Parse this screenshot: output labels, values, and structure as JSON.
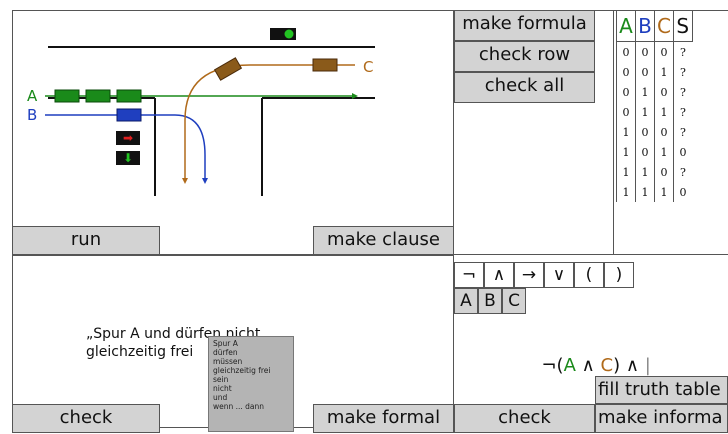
{
  "scene": {
    "lane_a_label": "A",
    "lane_b_label": "B",
    "lane_c_label": "C",
    "color_a": "#1a8a1a",
    "color_b": "#1f3fbf",
    "color_c": "#b06a1a",
    "traffic_light_state": "green"
  },
  "buttons": {
    "run": "run",
    "make_clause": "make clause",
    "make_formula": "make formula",
    "check_row": "check row",
    "check_all": "check all",
    "check_left": "check",
    "make_formal": "make formal",
    "check_right": "check",
    "fill_truth_table": "fill truth table",
    "make_informal": "make informa"
  },
  "truth_table": {
    "headers": [
      "A",
      "B",
      "C",
      "S"
    ],
    "rows": [
      [
        "0",
        "0",
        "0",
        "?"
      ],
      [
        "0",
        "0",
        "1",
        "?"
      ],
      [
        "0",
        "1",
        "0",
        "?"
      ],
      [
        "0",
        "1",
        "1",
        "?"
      ],
      [
        "1",
        "0",
        "0",
        "?"
      ],
      [
        "1",
        "0",
        "1",
        "0"
      ],
      [
        "1",
        "1",
        "0",
        "?"
      ],
      [
        "1",
        "1",
        "1",
        "0"
      ]
    ]
  },
  "sentence": {
    "line1": "„Spur A und dürfen nicht",
    "line2": "gleichzeitig frei"
  },
  "word_list": [
    "Spur A",
    "dürfen",
    "müssen",
    "gleichzeitig frei",
    "sein",
    "nicht",
    "und",
    "wenn ... dann"
  ],
  "operators": [
    "¬",
    "∧",
    "→",
    "∨",
    "(",
    ")"
  ],
  "variables": [
    "A",
    "B",
    "C"
  ],
  "formula": {
    "neg": "¬(",
    "a": "A",
    "and1": " ∧ ",
    "c": "C",
    "close": ") ∧ ",
    "cursor": "|"
  }
}
